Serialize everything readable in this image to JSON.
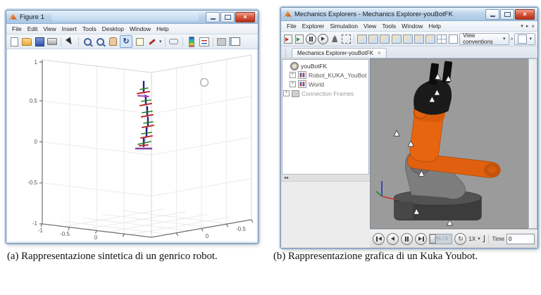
{
  "icons": {
    "close": "×",
    "dropdown": "▾",
    "rotate": "↻",
    "expander": "+",
    "splitter_left": "◂",
    "splitter_right": "▸",
    "overflow": "»"
  },
  "figure_window": {
    "title": "Figure 1",
    "menu": [
      "File",
      "Edit",
      "View",
      "Insert",
      "Tools",
      "Desktop",
      "Window",
      "Help"
    ],
    "plot": {
      "z_ticks": [
        "1",
        "0.5",
        "0",
        "-0.5",
        "-1"
      ],
      "x_ticks": [
        "-1",
        "-0.5",
        "0"
      ],
      "y_ticks": [
        "0",
        "-0.5"
      ]
    }
  },
  "mechanics_window": {
    "title": "Mechanics Explorers - Mechanics Explorer-youBotFK",
    "menu": [
      "File",
      "Explorer",
      "Simulation",
      "View",
      "Tools",
      "Window",
      "Help"
    ],
    "toolbar": {
      "view_conventions": "View conventions"
    },
    "tab": "Mechanics Explorer-youBotFK",
    "tree": [
      "youBotFK",
      "Robot_KUKA_YouBot",
      "World",
      "Connection Frames"
    ],
    "playback": {
      "progress": "0% / 0",
      "speed": "1X",
      "time_label": "Time",
      "time_value": "0"
    }
  },
  "captions": [
    {
      "label": "(a)",
      "text": "Rappresentazione sintetica di un genrico robot."
    },
    {
      "label": "(b)",
      "text": "Rappresentazione grafica di un Kuka Youbot."
    }
  ],
  "colors": {
    "kuka_orange": "#e0600f",
    "viewport_gray": "#9b9b9b",
    "titlebar_blue": "#bed5ec",
    "close_red": "#d95a3e"
  }
}
